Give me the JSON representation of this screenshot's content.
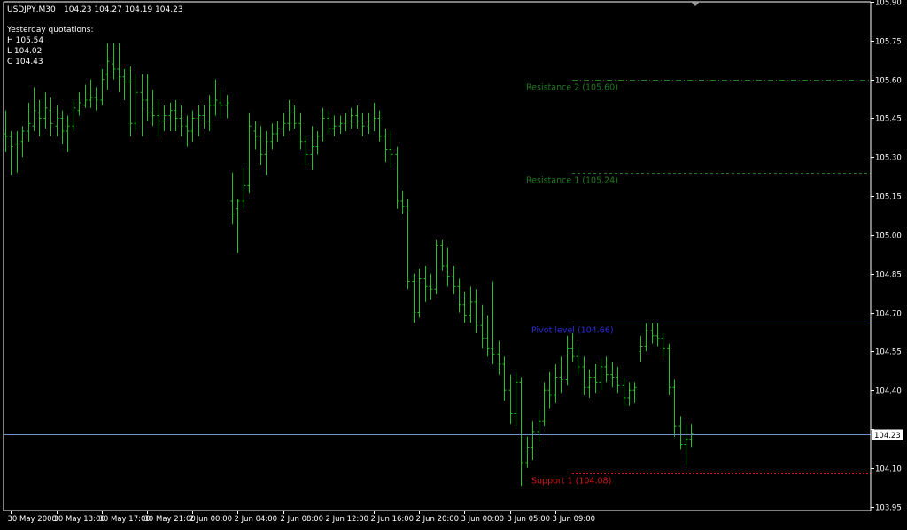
{
  "header": {
    "symbol": "USDJPY,M30",
    "ohlc": "104.23 104.27 104.19 104.23"
  },
  "info": {
    "title": "Yesterday quotations:",
    "high": "H 105.54",
    "low": "L 104.02",
    "close": "C 104.43"
  },
  "colors": {
    "background": "#000000",
    "bars": "#22c022",
    "axis": "#ffffff",
    "bid_line": "#6f8fc8",
    "resistance": "#1f7a1f",
    "pivot": "#2d2dd8",
    "support": "#d01818"
  },
  "chart_data": {
    "type": "ohlc",
    "x_ticks": [
      "30 May 2008",
      "30 May 13:00",
      "30 May 17:00",
      "30 May 21:00",
      "2 Jun 00:00",
      "2 Jun 04:00",
      "2 Jun 08:00",
      "2 Jun 12:00",
      "2 Jun 16:00",
      "2 Jun 20:00",
      "3 Jun 00:00",
      "3 Jun 05:00",
      "3 Jun 09:00"
    ],
    "y_ticks": [
      "105.90",
      "105.75",
      "105.60",
      "105.45",
      "105.30",
      "105.15",
      "105.00",
      "104.85",
      "104.70",
      "104.55",
      "104.40",
      "104.25",
      "104.10",
      "103.95"
    ],
    "ylim": [
      103.935,
      105.9
    ],
    "current_price": 104.23,
    "current_price_label": "104.23",
    "levels": [
      {
        "name": "Resistance 2",
        "label": "Resistance 2 (105.60)",
        "value": 105.6,
        "style": "dashdot",
        "color": "#1f7a1f"
      },
      {
        "name": "Resistance 1",
        "label": "Resistance 1 (105.24)",
        "value": 105.24,
        "style": "dashed",
        "color": "#1f7a1f"
      },
      {
        "name": "Pivot level",
        "label": "Pivot level (104.66)",
        "value": 104.66,
        "style": "solid",
        "color": "#2d2dd8"
      },
      {
        "name": "Support 1",
        "label": "Support 1 (104.08)",
        "value": 104.08,
        "style": "dotted",
        "color": "#d01818"
      }
    ],
    "bars": [
      [
        105.39,
        105.48,
        105.32,
        105.38
      ],
      [
        105.38,
        105.4,
        105.23,
        105.34
      ],
      [
        105.35,
        105.4,
        105.24,
        105.35
      ],
      [
        105.36,
        105.42,
        105.3,
        105.4
      ],
      [
        105.4,
        105.51,
        105.36,
        105.43
      ],
      [
        105.42,
        105.57,
        105.4,
        105.48
      ],
      [
        105.47,
        105.52,
        105.38,
        105.45
      ],
      [
        105.45,
        105.55,
        105.41,
        105.49
      ],
      [
        105.48,
        105.53,
        105.38,
        105.43
      ],
      [
        105.42,
        105.5,
        105.38,
        105.45
      ],
      [
        105.45,
        105.48,
        105.35,
        105.4
      ],
      [
        105.4,
        105.46,
        105.32,
        105.42
      ],
      [
        105.42,
        105.52,
        105.4,
        105.49
      ],
      [
        105.48,
        105.55,
        105.46,
        105.51
      ],
      [
        105.5,
        105.58,
        105.49,
        105.52
      ],
      [
        105.52,
        105.6,
        105.49,
        105.53
      ],
      [
        105.53,
        105.57,
        105.48,
        105.52
      ],
      [
        105.52,
        105.64,
        105.5,
        105.6
      ],
      [
        105.62,
        105.74,
        105.56,
        105.67
      ],
      [
        105.66,
        105.74,
        105.6,
        105.64
      ],
      [
        105.64,
        105.74,
        105.55,
        105.61
      ],
      [
        105.61,
        105.64,
        105.52,
        105.59
      ],
      [
        105.59,
        105.65,
        105.38,
        105.43
      ],
      [
        105.43,
        105.62,
        105.4,
        105.55
      ],
      [
        105.55,
        105.62,
        105.38,
        105.52
      ],
      [
        105.52,
        105.62,
        105.44,
        105.47
      ],
      [
        105.47,
        105.56,
        105.42,
        105.46
      ],
      [
        105.46,
        105.52,
        105.38,
        105.44
      ],
      [
        105.44,
        105.5,
        105.4,
        105.46
      ],
      [
        105.46,
        105.51,
        105.4,
        105.48
      ],
      [
        105.48,
        105.52,
        105.4,
        105.45
      ],
      [
        105.45,
        105.5,
        105.38,
        105.42
      ],
      [
        105.42,
        105.46,
        105.34,
        105.4
      ],
      [
        105.4,
        105.48,
        105.36,
        105.45
      ],
      [
        105.45,
        105.5,
        105.38,
        105.46
      ],
      [
        105.46,
        105.5,
        105.41,
        105.44
      ],
      [
        105.44,
        105.54,
        105.4,
        105.5
      ],
      [
        105.5,
        105.6,
        105.46,
        105.52
      ],
      [
        105.51,
        105.56,
        105.45,
        105.5
      ],
      [
        105.5,
        105.54,
        105.45,
        105.51
      ],
      [
        105.13,
        105.24,
        105.04,
        105.08
      ],
      [
        105.1,
        105.14,
        104.93,
        105.13
      ],
      [
        105.13,
        105.26,
        105.1,
        105.19
      ],
      [
        105.19,
        105.47,
        105.16,
        105.42
      ],
      [
        105.4,
        105.44,
        105.33,
        105.38
      ],
      [
        105.38,
        105.42,
        105.27,
        105.31
      ],
      [
        105.31,
        105.4,
        105.23,
        105.36
      ],
      [
        105.36,
        105.43,
        105.33,
        105.39
      ],
      [
        105.39,
        105.44,
        105.36,
        105.41
      ],
      [
        105.41,
        105.47,
        105.38,
        105.43
      ],
      [
        105.43,
        105.52,
        105.4,
        105.47
      ],
      [
        105.47,
        105.5,
        105.41,
        105.43
      ],
      [
        105.43,
        105.47,
        105.33,
        105.36
      ],
      [
        105.36,
        105.38,
        105.27,
        105.31
      ],
      [
        105.31,
        105.42,
        105.25,
        105.34
      ],
      [
        105.34,
        105.4,
        105.31,
        105.38
      ],
      [
        105.38,
        105.49,
        105.36,
        105.45
      ],
      [
        105.45,
        105.48,
        105.39,
        105.41
      ],
      [
        105.41,
        105.46,
        105.38,
        105.42
      ],
      [
        105.42,
        105.46,
        105.39,
        105.43
      ],
      [
        105.43,
        105.47,
        105.4,
        105.44
      ],
      [
        105.44,
        105.49,
        105.41,
        105.46
      ],
      [
        105.46,
        105.5,
        105.41,
        105.44
      ],
      [
        105.44,
        105.47,
        105.38,
        105.42
      ],
      [
        105.42,
        105.47,
        105.39,
        105.44
      ],
      [
        105.44,
        105.51,
        105.4,
        105.45
      ],
      [
        105.45,
        105.48,
        105.36,
        105.38
      ],
      [
        105.38,
        105.41,
        105.28,
        105.33
      ],
      [
        105.33,
        105.4,
        105.26,
        105.31
      ],
      [
        105.31,
        105.34,
        105.1,
        105.13
      ],
      [
        105.13,
        105.17,
        105.08,
        105.11
      ],
      [
        105.11,
        105.14,
        104.79,
        104.82
      ],
      [
        104.82,
        104.85,
        104.66,
        104.7
      ],
      [
        104.7,
        104.87,
        104.68,
        104.83
      ],
      [
        104.83,
        104.88,
        104.74,
        104.8
      ],
      [
        104.8,
        104.85,
        104.75,
        104.79
      ],
      [
        104.79,
        104.98,
        104.77,
        104.96
      ],
      [
        104.96,
        104.98,
        104.86,
        104.88
      ],
      [
        104.88,
        104.95,
        104.8,
        104.84
      ],
      [
        104.84,
        104.88,
        104.77,
        104.8
      ],
      [
        104.8,
        104.83,
        104.7,
        104.73
      ],
      [
        104.73,
        104.78,
        104.66,
        104.69
      ],
      [
        104.69,
        104.8,
        104.66,
        104.74
      ],
      [
        104.74,
        104.79,
        104.62,
        104.65
      ],
      [
        104.65,
        104.73,
        104.56,
        104.6
      ],
      [
        104.6,
        104.69,
        104.53,
        104.56
      ],
      [
        104.56,
        104.82,
        104.5,
        104.54
      ],
      [
        104.54,
        104.59,
        104.46,
        104.5
      ],
      [
        104.5,
        104.53,
        104.36,
        104.4
      ],
      [
        104.4,
        104.46,
        104.27,
        104.31
      ],
      [
        104.31,
        104.47,
        104.26,
        104.43
      ],
      [
        104.43,
        104.45,
        104.03,
        104.12
      ],
      [
        104.12,
        104.22,
        104.1,
        104.18
      ],
      [
        104.18,
        104.28,
        104.13,
        104.24
      ],
      [
        104.24,
        104.32,
        104.2,
        104.28
      ],
      [
        104.28,
        104.43,
        104.26,
        104.4
      ],
      [
        104.4,
        104.47,
        104.33,
        104.38
      ],
      [
        104.38,
        104.5,
        104.35,
        104.45
      ],
      [
        104.45,
        104.53,
        104.39,
        104.44
      ],
      [
        104.44,
        104.61,
        104.42,
        104.56
      ],
      [
        104.56,
        104.62,
        104.51,
        104.53
      ],
      [
        104.53,
        104.57,
        104.46,
        104.49
      ],
      [
        104.49,
        104.53,
        104.38,
        104.41
      ],
      [
        104.41,
        104.48,
        104.37,
        104.45
      ],
      [
        104.45,
        104.5,
        104.39,
        104.43
      ],
      [
        104.43,
        104.52,
        104.4,
        104.49
      ],
      [
        104.49,
        104.53,
        104.43,
        104.46
      ],
      [
        104.46,
        104.51,
        104.41,
        104.45
      ],
      [
        104.45,
        104.49,
        104.39,
        104.42
      ],
      [
        104.42,
        104.45,
        104.34,
        104.37
      ],
      [
        104.37,
        104.43,
        104.34,
        104.4
      ],
      [
        104.4,
        104.43,
        104.35,
        104.41
      ],
      [
        104.55,
        104.61,
        104.51,
        104.57
      ],
      [
        104.57,
        104.66,
        104.55,
        104.63
      ],
      [
        104.63,
        104.66,
        104.58,
        104.61
      ],
      [
        104.61,
        104.66,
        104.57,
        104.6
      ],
      [
        104.6,
        104.62,
        104.53,
        104.56
      ],
      [
        104.56,
        104.58,
        104.38,
        104.41
      ],
      [
        104.41,
        104.44,
        104.22,
        104.26
      ],
      [
        104.26,
        104.3,
        104.17,
        104.19
      ],
      [
        104.19,
        104.27,
        104.11,
        104.21
      ],
      [
        104.21,
        104.27,
        104.18,
        104.23
      ]
    ]
  }
}
